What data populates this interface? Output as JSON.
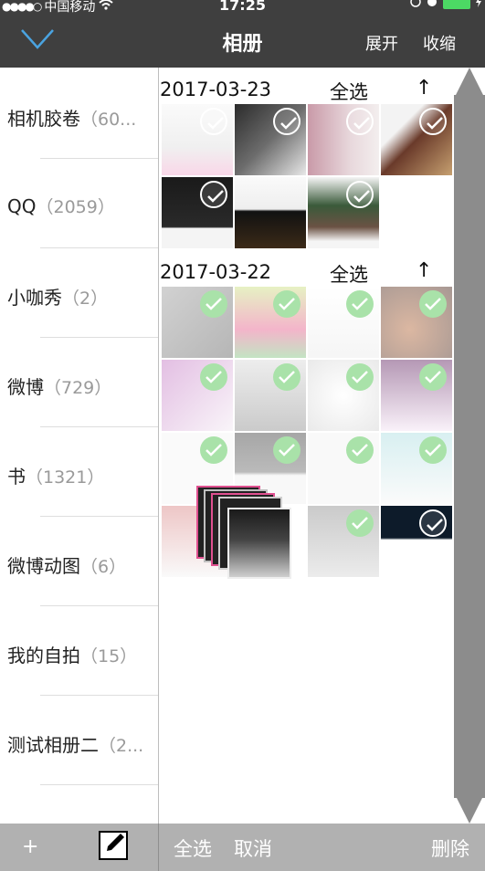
{
  "status_bar": {
    "carrier": "中国移动",
    "time": "17:25"
  },
  "nav": {
    "title": "相册",
    "expand": "展开",
    "collapse": "收缩"
  },
  "albums": [
    {
      "name": "相机胶卷",
      "count": "（60..."
    },
    {
      "name": "QQ",
      "count": "（2059）"
    },
    {
      "name": "小咖秀",
      "count": "（2）"
    },
    {
      "name": "微博",
      "count": "（729）"
    },
    {
      "name": "书",
      "count": "（1321）"
    },
    {
      "name": "微博动图",
      "count": "（6）"
    },
    {
      "name": "我的自拍",
      "count": "（15）"
    },
    {
      "name": "测试相册二",
      "count": "（2..."
    }
  ],
  "sections": [
    {
      "date": "2017-03-23",
      "select_all": "全选",
      "sort_icon": "up-arrow-icon"
    },
    {
      "date": "2017-03-22",
      "select_all": "全选",
      "sort_icon": "up-arrow-icon"
    }
  ],
  "bottom_bar": {
    "add": "+",
    "select_all": "全选",
    "cancel": "取消",
    "delete": "删除"
  },
  "colors": {
    "bar": "#3f3f3f",
    "bottom_bar": "#b1b1b1",
    "check_green": "#a9e2a9",
    "battery": "#4cd964",
    "scroll_track": "#8c8c8c"
  }
}
